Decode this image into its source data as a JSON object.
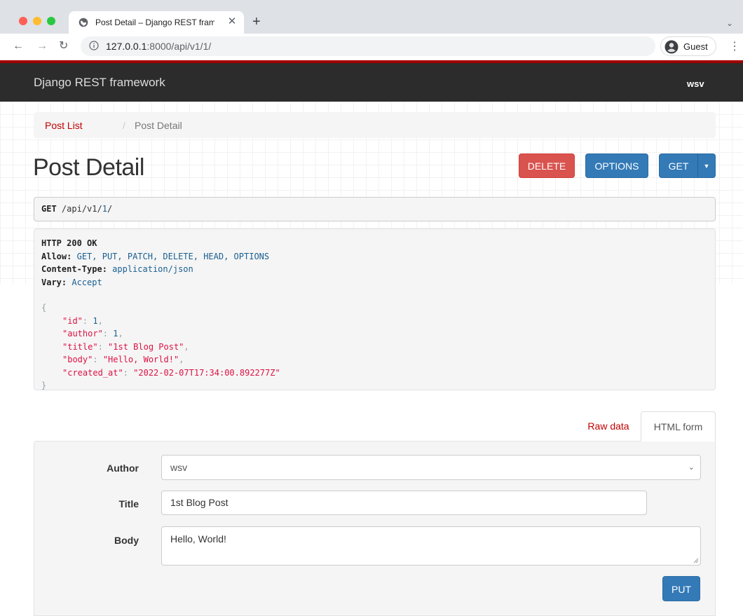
{
  "browser": {
    "tab_title": "Post Detail – Django REST fram",
    "url_host": "127.0.0.1",
    "url_rest": ":8000/api/v1/1/",
    "profile_label": "Guest",
    "new_tab_glyph": "+",
    "close_glyph": "✕",
    "icons": [
      "globe-icon",
      "close-icon",
      "plus-icon",
      "chevron-down-icon",
      "back-icon",
      "forward-icon",
      "reload-icon",
      "info-icon",
      "profile-icon",
      "kebab-menu-icon"
    ]
  },
  "navbar": {
    "brand": "Django REST framework",
    "user": "wsv",
    "accent_color": "#a30000"
  },
  "breadcrumb": {
    "link": "Post List",
    "separator": "/",
    "current": "Post Detail"
  },
  "page": {
    "title": "Post Detail"
  },
  "actions": {
    "delete": "DELETE",
    "options": "OPTIONS",
    "get": "GET",
    "delete_color": "#d9534f",
    "primary_color": "#337ab7"
  },
  "request": {
    "method": "GET",
    "path_prefix": "/api/v1/",
    "path_id": "1",
    "path_suffix": "/"
  },
  "response": {
    "status": "HTTP 200 OK",
    "headers": [
      {
        "name": "Allow:",
        "value": "GET, PUT, PATCH, DELETE, HEAD, OPTIONS"
      },
      {
        "name": "Content-Type:",
        "value": "application/json"
      },
      {
        "name": "Vary:",
        "value": "Accept"
      }
    ],
    "open_brace": "{",
    "close_brace": "}",
    "fields": [
      {
        "key": "\"id\"",
        "value": "1",
        "kind": "lit",
        "comma": ","
      },
      {
        "key": "\"author\"",
        "value": "1",
        "kind": "lit",
        "comma": ","
      },
      {
        "key": "\"title\"",
        "value": "\"1st Blog Post\"",
        "kind": "str",
        "comma": ","
      },
      {
        "key": "\"body\"",
        "value": "\"Hello, World!\"",
        "kind": "str",
        "comma": ","
      },
      {
        "key": "\"created_at\"",
        "value": "\"2022-02-07T17:34:00.892277Z\"",
        "kind": "str",
        "comma": ""
      }
    ]
  },
  "form_tabs": {
    "raw": "Raw data",
    "html": "HTML form"
  },
  "form": {
    "author_label": "Author",
    "author_value": "wsv",
    "title_label": "Title",
    "title_value": "1st Blog Post",
    "body_label": "Body",
    "body_value": "Hello, World!",
    "submit": "PUT"
  }
}
